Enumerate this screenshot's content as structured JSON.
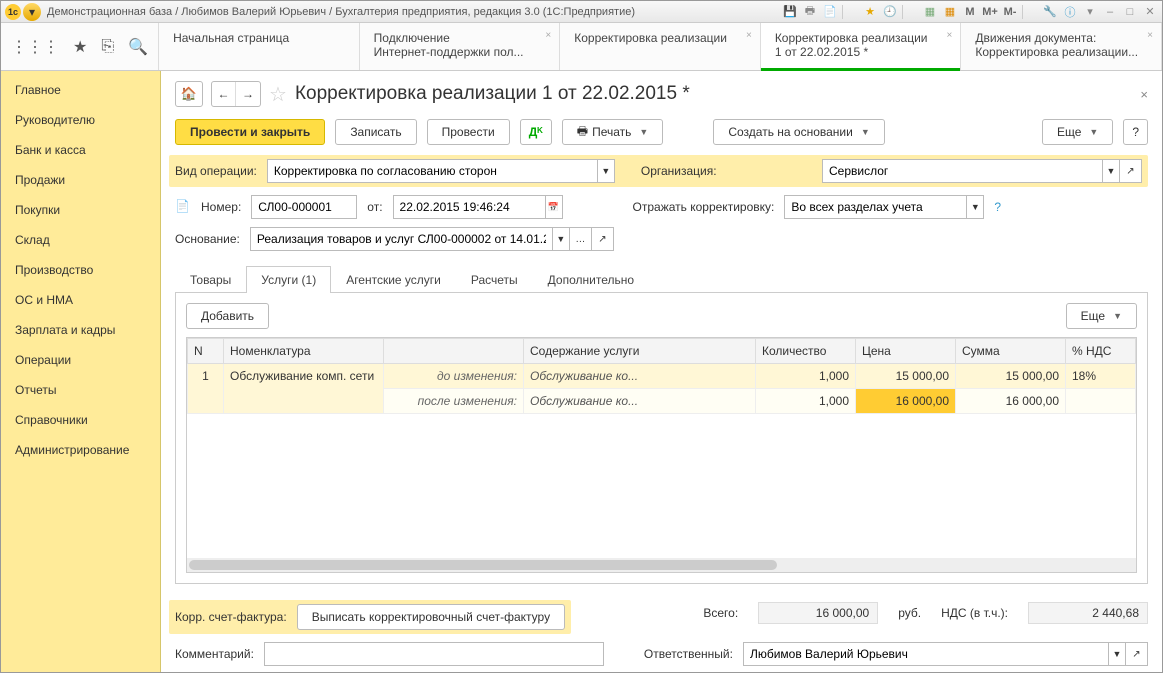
{
  "window": {
    "title": "Демонстрационная база / Любимов Валерий Юрьевич / Бухгалтерия предприятия, редакция 3.0  (1С:Предприятие)"
  },
  "top_tabs": [
    {
      "line1": "Начальная страница",
      "line2": ""
    },
    {
      "line1": "Подключение",
      "line2": "Интернет-поддержки пол..."
    },
    {
      "line1": "Корректировка реализации",
      "line2": ""
    },
    {
      "line1": "Корректировка реализации",
      "line2": "1 от 22.02.2015 *",
      "active": true
    },
    {
      "line1": "Движения документа:",
      "line2": "Корректировка реализации..."
    }
  ],
  "sidebar": [
    "Главное",
    "Руководителю",
    "Банк и касса",
    "Продажи",
    "Покупки",
    "Склад",
    "Производство",
    "ОС и НМА",
    "Зарплата и кадры",
    "Операции",
    "Отчеты",
    "Справочники",
    "Администрирование"
  ],
  "page": {
    "title": "Корректировка реализации 1 от 22.02.2015 *"
  },
  "toolbar": {
    "post_close": "Провести и закрыть",
    "save": "Записать",
    "post": "Провести",
    "print": "Печать",
    "create_based": "Создать на основании",
    "more": "Еще"
  },
  "form": {
    "op_type_label": "Вид операции:",
    "op_type_value": "Корректировка по согласованию сторон",
    "org_label": "Организация:",
    "org_value": "Сервислог",
    "number_label": "Номер:",
    "number_value": "СЛ00-000001",
    "date_label": "от:",
    "date_value": "22.02.2015 19:46:24",
    "reflect_label": "Отражать корректировку:",
    "reflect_value": "Во всех разделах учета",
    "basis_label": "Основание:",
    "basis_value": "Реализация товаров и услуг СЛ00-000002 от 14.01.2"
  },
  "tabs": {
    "goods": "Товары",
    "services": "Услуги (1)",
    "agent": "Агентские услуги",
    "calc": "Расчеты",
    "extra": "Дополнительно"
  },
  "panel": {
    "add": "Добавить",
    "more": "Еще"
  },
  "grid": {
    "cols": {
      "n": "N",
      "nom": "Номенклатура",
      "content": "Содержание услуги",
      "qty": "Количество",
      "price": "Цена",
      "sum": "Сумма",
      "vat": "% НДС"
    },
    "before_label": "до изменения:",
    "after_label": "после изменения:",
    "row": {
      "n": "1",
      "nom": "Обслуживание комп. сети",
      "before": {
        "content": "Обслуживание ко...",
        "qty": "1,000",
        "price": "15 000,00",
        "sum": "15 000,00",
        "vat": "18%"
      },
      "after": {
        "content": "Обслуживание ко...",
        "qty": "1,000",
        "price": "16 000,00",
        "sum": "16 000,00",
        "vat": ""
      }
    }
  },
  "footer": {
    "corr_invoice_label": "Корр. счет-фактура:",
    "corr_invoice_btn": "Выписать корректировочный счет-фактуру",
    "total_label": "Всего:",
    "total_value": "16 000,00",
    "currency": "руб.",
    "vat_label": "НДС (в т.ч.):",
    "vat_value": "2 440,68",
    "comment_label": "Комментарий:",
    "responsible_label": "Ответственный:",
    "responsible_value": "Любимов Валерий Юрьевич"
  }
}
